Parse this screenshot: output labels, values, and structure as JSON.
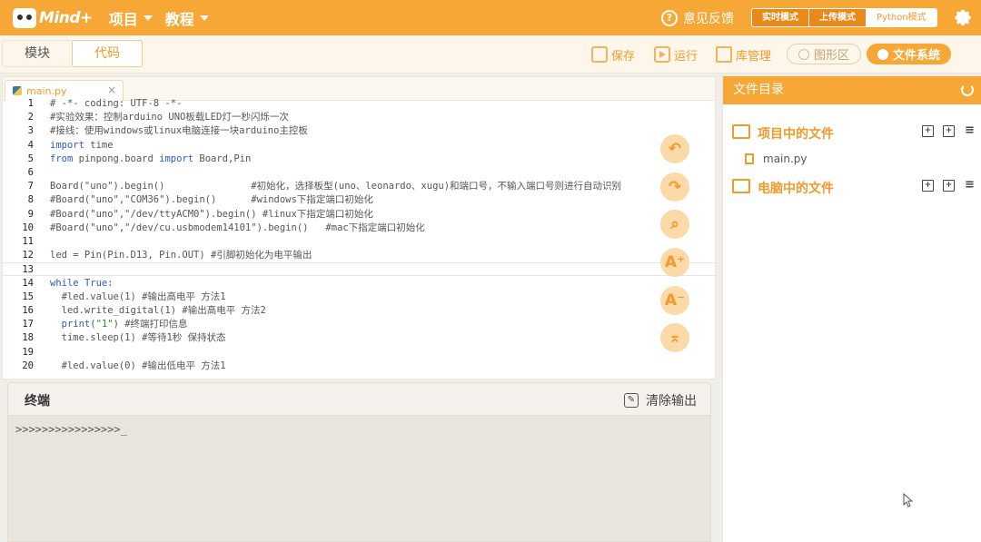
{
  "app": {
    "logo_text": "Mind+",
    "menu": [
      {
        "label": "项目"
      },
      {
        "label": "教程"
      }
    ],
    "feedback_label": "意见反馈",
    "modes": [
      "实时模式",
      "上传模式",
      "Python模式"
    ],
    "active_mode": "Python模式"
  },
  "toolbar": {
    "tab_blocks": "模块",
    "tab_code": "代码",
    "save_label": "保存",
    "run_label": "运行",
    "lib_label": "库管理",
    "graph_label": "图形区",
    "fs_label": "文件系统"
  },
  "editor": {
    "file_tab": "main.py",
    "close_glyph": "×",
    "lines": [
      {
        "n": "1",
        "text": "# -*- coding: UTF-8 -*-"
      },
      {
        "n": "2",
        "text": "#实验效果：控制arduino UNO板载LED灯一秒闪烁一次"
      },
      {
        "n": "3",
        "text": "#接线：使用windows或linux电脑连接一块arduino主控板"
      },
      {
        "n": "4",
        "text": "import time"
      },
      {
        "n": "5",
        "text": "from pinpong.board import Board,Pin"
      },
      {
        "n": "6",
        "text": ""
      },
      {
        "n": "7",
        "text": "Board(\"uno\").begin()               #初始化，选择板型(uno、leonardo、xugu)和端口号，不输入端口号则进行自动识别"
      },
      {
        "n": "8",
        "text": "#Board(\"uno\",\"COM36\").begin()      #windows下指定端口初始化"
      },
      {
        "n": "9",
        "text": "#Board(\"uno\",\"/dev/ttyACM0\").begin() #linux下指定端口初始化"
      },
      {
        "n": "10",
        "text": "#Board(\"uno\",\"/dev/cu.usbmodem14101\").begin()   #mac下指定端口初始化"
      },
      {
        "n": "11",
        "text": ""
      },
      {
        "n": "12",
        "text": "led = Pin(Pin.D13, Pin.OUT) #引脚初始化为电平输出"
      },
      {
        "n": "13",
        "text": ""
      },
      {
        "n": "14",
        "text": "while True:"
      },
      {
        "n": "15",
        "text": "  #led.value(1) #输出高电平 方法1"
      },
      {
        "n": "16",
        "text": "  led.write_digital(1) #输出高电平 方法2"
      },
      {
        "n": "17",
        "text": "  print(\"1\") #终端打印信息"
      },
      {
        "n": "18",
        "text": "  time.sleep(1) #等待1秒 保持状态"
      },
      {
        "n": "19",
        "text": ""
      },
      {
        "n": "20",
        "text": "  #led.value(0) #输出低电平 方法1"
      }
    ]
  },
  "terminal": {
    "title": "终端",
    "clear_label": "清除输出",
    "output": ">>>>>>>>>>>>>>>>_"
  },
  "file_panel": {
    "title": "文件目录",
    "project_section": "项目中的文件",
    "project_files": [
      "main.py"
    ],
    "computer_section": "电脑中的文件"
  },
  "colors": {
    "brand": "#f7a735",
    "accent": "#f39a2a"
  }
}
